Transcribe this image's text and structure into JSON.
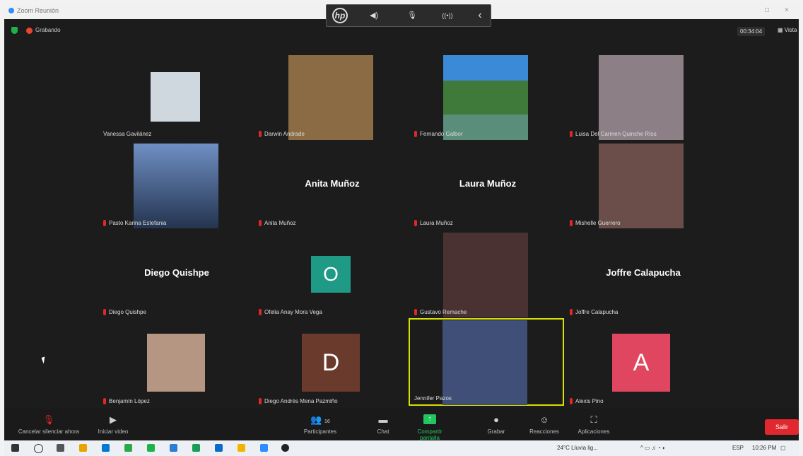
{
  "window": {
    "title": "Zoom Reunión",
    "minimize": "□",
    "close": "×"
  },
  "hp_bar": {
    "logo": "hp",
    "speaker": "◀)",
    "mic": "🎙",
    "broadcast": "((•))",
    "collapse": "‹"
  },
  "meeting": {
    "recording_label": "Grabando",
    "timer": "00:34:04",
    "view_label": "Vista"
  },
  "participants": [
    {
      "name": "Vanessa Gavilánez",
      "muted": false,
      "kind": "video",
      "bg": "#cfd8de"
    },
    {
      "name": "Darwin Andrade",
      "muted": true,
      "kind": "video",
      "bg": "#8a6b44"
    },
    {
      "name": "Fernando Galbor",
      "muted": true,
      "kind": "video",
      "bg": "#3f7a3a"
    },
    {
      "name": "Luisa Del Carmen Quinche Ríos",
      "muted": true,
      "kind": "video",
      "bg": "#8c7f86"
    },
    {
      "name": "Pasto Karina Estefania",
      "muted": true,
      "kind": "video",
      "bg": "#3a5d8f"
    },
    {
      "name": "Anita Muñoz",
      "display": "Anita Muñoz",
      "muted": true,
      "kind": "name"
    },
    {
      "name": "Laura Muñoz",
      "display": "Laura Muñoz",
      "muted": true,
      "kind": "name"
    },
    {
      "name": "Mishelle Guerrero",
      "muted": true,
      "kind": "video",
      "bg": "#6b4e4a"
    },
    {
      "name": "Diego Quishpe",
      "display": "Diego Quishpe",
      "muted": true,
      "kind": "name"
    },
    {
      "name": "Ofelia Anay Mora Vega",
      "avatar": "O",
      "avatar_color": "#1f9a86",
      "muted": true,
      "kind": "avatar"
    },
    {
      "name": "Gustavo Remache",
      "muted": true,
      "kind": "video",
      "bg": "#4a3232"
    },
    {
      "name": "Joffre Calapucha",
      "display": "Joffre Calapucha",
      "muted": true,
      "kind": "name"
    },
    {
      "name": "Benjamín López",
      "muted": true,
      "kind": "video",
      "bg": "#b49682"
    },
    {
      "name": "Diego Andrés Mena Pazmiño",
      "avatar": "D",
      "avatar_color": "#6a3a2c",
      "muted": true,
      "kind": "avatar"
    },
    {
      "name": "Jennifer Pazos",
      "muted": false,
      "kind": "video",
      "bg": "#3f4f78",
      "active": true
    },
    {
      "name": "Alexis Pino",
      "avatar": "A",
      "avatar_color": "#e0465f",
      "muted": true,
      "kind": "avatar"
    }
  ],
  "toolbar": {
    "mute": "Cancelar silenciar ahora",
    "video": "Iniciar video",
    "participants": "Participantes",
    "participants_count": "16",
    "chat": "Chat",
    "share": "Compartir pantalla",
    "record": "Grabar",
    "reactions": "Reacciones",
    "apps": "Aplicaciones",
    "leave": "Salir"
  },
  "taskbar": {
    "temp": "24°C",
    "weather": "Lluvia lig...",
    "lang": "ESP",
    "time": "10:26 PM",
    "app_colors": [
      "#0078d4",
      "#e8a400",
      "#1e88e5",
      "#2aa84a",
      "#20b24a",
      "#2d8cff",
      "#2b7cd3",
      "#1a9d54",
      "#0b6bcb",
      "#f0b400",
      "#2d8cff",
      "#222222"
    ]
  },
  "colors": {
    "accent_green": "#22c55e",
    "leave_red": "#e0282e",
    "active_border": "#d8e000"
  }
}
